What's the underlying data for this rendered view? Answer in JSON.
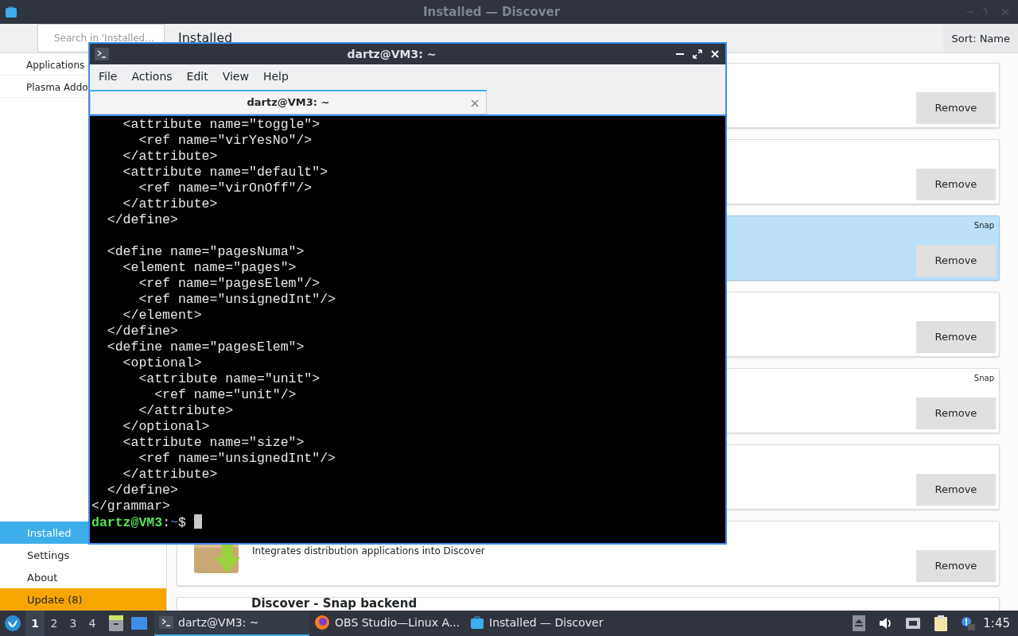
{
  "discover": {
    "title": "Installed — Discover",
    "search": {
      "placeholder": "Search in 'Installed..."
    },
    "heading": "Installed",
    "sort": "Sort: Name",
    "sidebar": {
      "top_items": [
        {
          "label": "Applications"
        },
        {
          "label": "Plasma Addo"
        }
      ],
      "bottom_items": [
        {
          "label": "Installed",
          "selected": true,
          "kind": "nav"
        },
        {
          "label": "Settings",
          "selected": false,
          "kind": "nav"
        },
        {
          "label": "About",
          "selected": false,
          "kind": "nav"
        },
        {
          "label": "Update (8)",
          "selected": false,
          "kind": "update"
        }
      ]
    },
    "apps": [
      {
        "selected": false,
        "button": "Remove"
      },
      {
        "selected": false,
        "button": "Remove"
      },
      {
        "selected": true,
        "badge": "Snap",
        "button": "Remove"
      },
      {
        "selected": false,
        "button": "Remove"
      },
      {
        "selected": false,
        "badge": "Snap",
        "button": "Remove"
      },
      {
        "selected": false,
        "button": "Remove"
      },
      {
        "selected": false,
        "kind": "package",
        "description": "Integrates distribution applications into Discover",
        "button": "Remove"
      },
      {
        "selected": false,
        "name": "Discover - Snap backend"
      }
    ]
  },
  "terminal": {
    "title": "dartz@VM3: ~",
    "menu": [
      "File",
      "Actions",
      "Edit",
      "View",
      "Help"
    ],
    "tabs": [
      {
        "label": "dartz@VM3: ~",
        "selected": true
      }
    ],
    "output_blocks": [
      [
        "    <attribute name=\"toggle\">",
        "      <ref name=\"virYesNo\"/>",
        "    </attribute>",
        "    <attribute name=\"default\">",
        "      <ref name=\"virOnOff\"/>",
        "    </attribute>",
        "  </define>"
      ],
      [
        "  <define name=\"pagesNuma\">",
        "    <element name=\"pages\">",
        "      <ref name=\"pagesElem\"/>",
        "      <ref name=\"unsignedInt\"/>",
        "    </element>",
        "  </define>",
        "  <define name=\"pagesElem\">",
        "    <optional>",
        "      <attribute name=\"unit\">",
        "        <ref name=\"unit\"/>",
        "      </attribute>",
        "    </optional>",
        "    <attribute name=\"size\">",
        "      <ref name=\"unsignedInt\"/>",
        "    </attribute>",
        "  </define>",
        "</grammar>"
      ]
    ],
    "prompt": {
      "user_host": "dartz@VM3",
      "separator": ":",
      "path": "~",
      "symbol": "$"
    }
  },
  "taskbar": {
    "workspaces": [
      {
        "label": "1",
        "selected": true
      },
      {
        "label": "2",
        "selected": false
      },
      {
        "label": "3",
        "selected": false
      },
      {
        "label": "4",
        "selected": false
      }
    ],
    "tasks": [
      {
        "kind": "terminal",
        "label": "dartz@VM3: ~",
        "selected": true
      },
      {
        "kind": "browser",
        "label": "OBS Studio—Linux A...",
        "selected": false
      },
      {
        "kind": "store",
        "label": "Installed — Discover",
        "selected": false
      }
    ],
    "clock": "1:45"
  }
}
